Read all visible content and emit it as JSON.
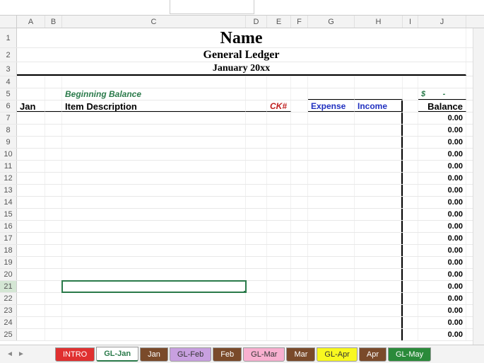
{
  "columns": [
    "A",
    "B",
    "C",
    "D",
    "E",
    "F",
    "G",
    "H",
    "I",
    "J"
  ],
  "title": "Name",
  "subtitle": "General Ledger",
  "period": "January 20xx",
  "beginning_label": "Beginning Balance",
  "dollar": "$",
  "dash": "-",
  "headers": {
    "month": "Jan",
    "item": "Item Description",
    "ck": "CK#",
    "expense": "Expense",
    "income": "Income",
    "balance": "Balance"
  },
  "bal_val": "0.00",
  "row_nums": [
    "1",
    "2",
    "3",
    "4",
    "5",
    "6",
    "7",
    "8",
    "9",
    "10",
    "11",
    "12",
    "13",
    "14",
    "15",
    "16",
    "17",
    "18",
    "19",
    "20",
    "21",
    "22",
    "23",
    "24",
    "25"
  ],
  "tabs": [
    {
      "label": "INTRO",
      "bg": "#e03030",
      "fg": "#fff"
    },
    {
      "label": "GL-Jan",
      "bg": "#fff",
      "fg": "#2a7a4a",
      "active": true
    },
    {
      "label": "Jan",
      "bg": "#7a4a2a",
      "fg": "#fff"
    },
    {
      "label": "GL-Feb",
      "bg": "#c8a0e0",
      "fg": "#333"
    },
    {
      "label": "Feb",
      "bg": "#7a4a2a",
      "fg": "#fff"
    },
    {
      "label": "GL-Mar",
      "bg": "#f8b0d0",
      "fg": "#333"
    },
    {
      "label": "Mar",
      "bg": "#7a4a2a",
      "fg": "#fff"
    },
    {
      "label": "GL-Apr",
      "bg": "#f8f820",
      "fg": "#333"
    },
    {
      "label": "Apr",
      "bg": "#7a4a2a",
      "fg": "#fff"
    },
    {
      "label": "GL-May",
      "bg": "#2a8a3a",
      "fg": "#fff"
    }
  ],
  "nav": {
    "prev": "◄",
    "next": "►"
  }
}
